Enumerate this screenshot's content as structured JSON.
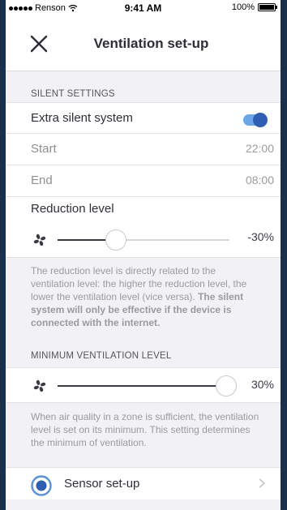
{
  "status_bar": {
    "carrier": "Renson",
    "time": "9:41 AM",
    "battery": "100%",
    "battery_level": 1.0
  },
  "nav": {
    "title": "Ventilation set-up",
    "close_icon": "close-icon"
  },
  "silent_settings": {
    "header": "SILENT SETTINGS",
    "extra_silent": {
      "label": "Extra silent system",
      "enabled": true
    },
    "start": {
      "label": "Start",
      "value": "22:00"
    },
    "end": {
      "label": "End",
      "value": "08:00"
    },
    "reduction": {
      "label": "Reduction level",
      "value": "-30%",
      "level": 0.34,
      "icon": "fan-icon"
    },
    "info_part1": "The reduction level is directly related to the ventilation level: the higher the reduction level, the lower the ventilation level (vice versa). ",
    "info_bold": "The silent system will only be effective if the device is connected with the internet."
  },
  "minimum_ventilation": {
    "header": "MINIMUM VENTILATION LEVEL",
    "value": "30%",
    "level": 1.0,
    "icon": "fan-icon",
    "info": "When air quality in a zone is sufficient, the ventilation level is set on its minimum. This setting determines the minimum of ventilation."
  },
  "sensor_setup": {
    "label": "Sensor set-up",
    "icon": "radio-icon",
    "chevron": "chevron-right-icon"
  },
  "colors": {
    "accent": "#2f5fb3",
    "toggle_track": "#6aa6e8",
    "background": "#f2f2f4",
    "outer": "#1a2f4a"
  }
}
